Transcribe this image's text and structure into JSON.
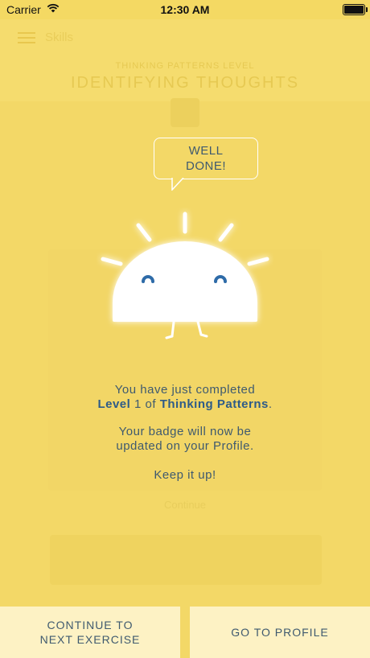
{
  "status_bar": {
    "carrier": "Carrier",
    "time": "12:30 AM"
  },
  "background": {
    "nav_label": "Skills",
    "subtitle": "THINKING PATTERNS LEVEL",
    "title": "IDENTIFYING THOUGHTS",
    "keep_going": "Continue"
  },
  "bubble": {
    "line1": "WELL",
    "line2": "DONE!"
  },
  "message": {
    "line1_prefix": "You have just completed",
    "level_word": "Level",
    "level_number": "1",
    "of_word": "of",
    "topic": "Thinking Patterns",
    "period": ".",
    "badge_line1": "Your badge will now be",
    "badge_line2": "updated on your Profile.",
    "keep_it_up": "Keep it up!"
  },
  "buttons": {
    "continue_line1": "CONTINUE TO",
    "continue_line2": "NEXT EXERCISE",
    "profile": "GO TO PROFILE"
  },
  "colors": {
    "overlay": "#f3d867",
    "text": "#3f5a6f",
    "accent": "#2e5b88",
    "button_bg": "#fdf2c4"
  }
}
